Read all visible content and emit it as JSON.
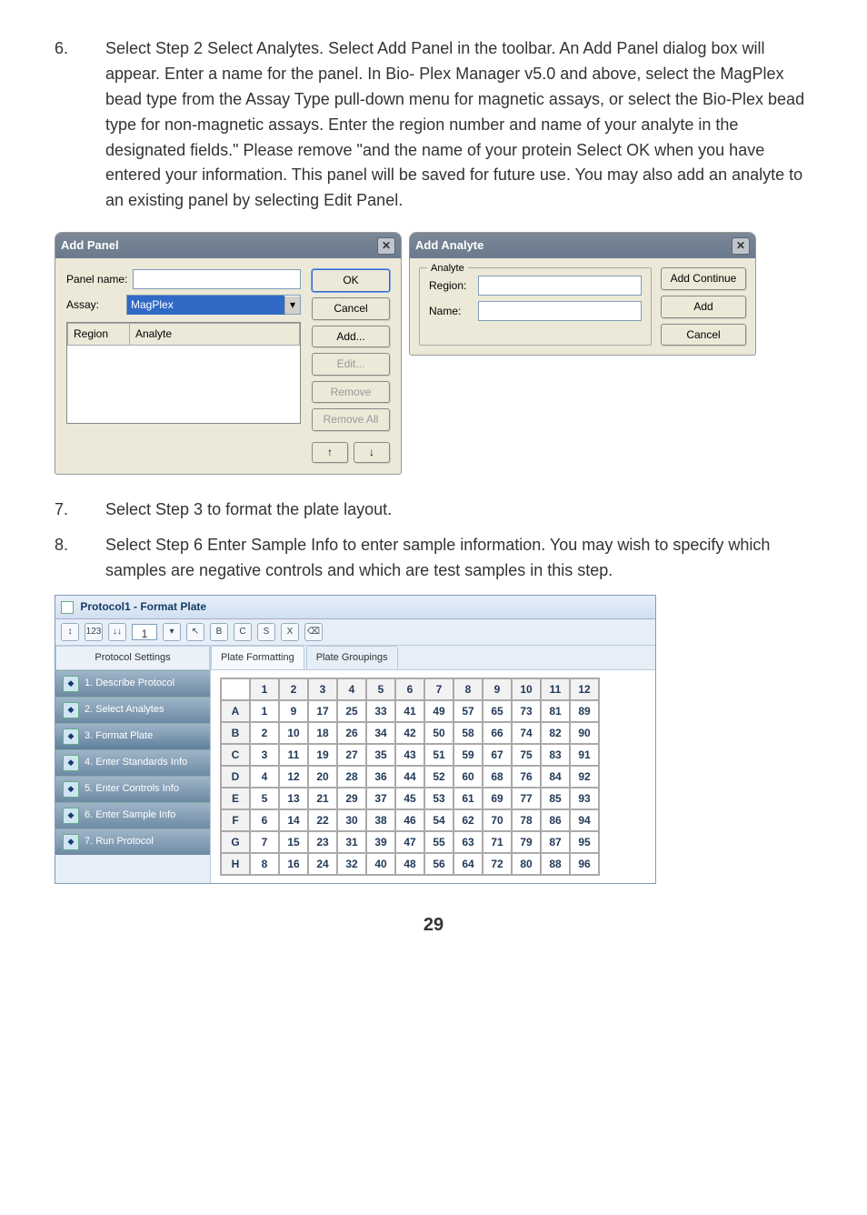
{
  "items": [
    {
      "num": "6.",
      "text": "Select Step 2 Select Analytes. Select Add Panel in the toolbar. An Add Panel dialog box will appear. Enter a name for the panel.  In Bio- Plex Manager v5.0 and above, select the MagPlex bead type from the Assay Type pull-down menu for magnetic assays, or select the Bio-Plex bead type for non-magnetic assays.  Enter the region number and name of your analyte in the designated fields.\"  Please remove \"and the name of your protein Select OK when you have entered your information. This panel will be saved for future use. You may also add an analyte to an existing panel by selecting Edit Panel."
    },
    {
      "num": "7.",
      "text": "Select Step 3 to format the plate layout."
    },
    {
      "num": "8.",
      "text": "Select Step 6 Enter Sample Info to enter sample information. You may wish to specify which samples are negative controls and which are test samples in this step."
    }
  ],
  "addPanel": {
    "title": "Add Panel",
    "panelNameLabel": "Panel name:",
    "assayLabel": "Assay:",
    "assayValue": "MagPlex",
    "cols": {
      "region": "Region",
      "analyte": "Analyte"
    },
    "buttons": {
      "ok": "OK",
      "cancel": "Cancel",
      "add": "Add...",
      "edit": "Edit...",
      "remove": "Remove",
      "removeAll": "Remove All",
      "up": "↑",
      "down": "↓"
    }
  },
  "addAnalyte": {
    "title": "Add Analyte",
    "group": "Analyte",
    "regionLabel": "Region:",
    "nameLabel": "Name:",
    "buttons": {
      "addContinue": "Add Continue",
      "add": "Add",
      "cancel": "Cancel"
    }
  },
  "fp": {
    "title": "Protocol1 - Format Plate",
    "protocolSettings": "Protocol Settings",
    "toolbarNumber": "1",
    "steps": [
      "1. Describe Protocol",
      "2. Select Analytes",
      "3. Format Plate",
      "4. Enter Standards Info",
      "5. Enter Controls Info",
      "6. Enter Sample Info",
      "7. Run Protocol"
    ],
    "tabs": {
      "formatting": "Plate Formatting",
      "groupings": "Plate Groupings"
    },
    "cols": [
      "1",
      "2",
      "3",
      "4",
      "5",
      "6",
      "7",
      "8",
      "9",
      "10",
      "11",
      "12"
    ],
    "rows": [
      "A",
      "B",
      "C",
      "D",
      "E",
      "F",
      "G",
      "H"
    ]
  },
  "chart_data": {
    "type": "table",
    "title": "Plate Formatting",
    "columns": [
      "1",
      "2",
      "3",
      "4",
      "5",
      "6",
      "7",
      "8",
      "9",
      "10",
      "11",
      "12"
    ],
    "rows": [
      "A",
      "B",
      "C",
      "D",
      "E",
      "F",
      "G",
      "H"
    ],
    "values": [
      [
        1,
        9,
        17,
        25,
        33,
        41,
        49,
        57,
        65,
        73,
        81,
        89
      ],
      [
        2,
        10,
        18,
        26,
        34,
        42,
        50,
        58,
        66,
        74,
        82,
        90
      ],
      [
        3,
        11,
        19,
        27,
        35,
        43,
        51,
        59,
        67,
        75,
        83,
        91
      ],
      [
        4,
        12,
        20,
        28,
        36,
        44,
        52,
        60,
        68,
        76,
        84,
        92
      ],
      [
        5,
        13,
        21,
        29,
        37,
        45,
        53,
        61,
        69,
        77,
        85,
        93
      ],
      [
        6,
        14,
        22,
        30,
        38,
        46,
        54,
        62,
        70,
        78,
        86,
        94
      ],
      [
        7,
        15,
        23,
        31,
        39,
        47,
        55,
        63,
        71,
        79,
        87,
        95
      ],
      [
        8,
        16,
        24,
        32,
        40,
        48,
        56,
        64,
        72,
        80,
        88,
        96
      ]
    ]
  },
  "pageNumber": "29"
}
